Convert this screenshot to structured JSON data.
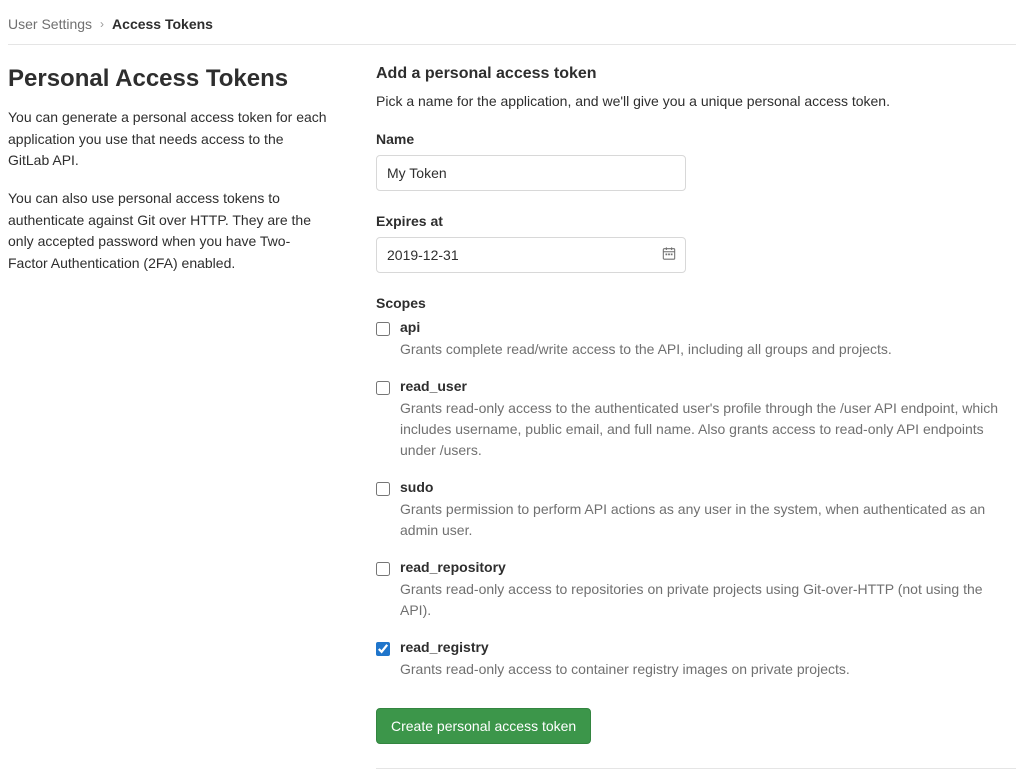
{
  "breadcrumb": {
    "root": "User Settings",
    "current": "Access Tokens"
  },
  "sidebar": {
    "heading": "Personal Access Tokens",
    "para1": "You can generate a personal access token for each application you use that needs access to the GitLab API.",
    "para2": "You can also use personal access tokens to authenticate against Git over HTTP. They are the only accepted password when you have Two-Factor Authentication (2FA) enabled."
  },
  "form": {
    "heading": "Add a personal access token",
    "subtext": "Pick a name for the application, and we'll give you a unique personal access token.",
    "name_label": "Name",
    "name_value": "My Token",
    "expires_label": "Expires at",
    "expires_value": "2019-12-31",
    "scopes_label": "Scopes",
    "submit_label": "Create personal access token"
  },
  "scopes": [
    {
      "name": "api",
      "checked": false,
      "desc": "Grants complete read/write access to the API, including all groups and projects."
    },
    {
      "name": "read_user",
      "checked": false,
      "desc": "Grants read-only access to the authenticated user's profile through the /user API endpoint, which includes username, public email, and full name. Also grants access to read-only API endpoints under /users."
    },
    {
      "name": "sudo",
      "checked": false,
      "desc": "Grants permission to perform API actions as any user in the system, when authenticated as an admin user."
    },
    {
      "name": "read_repository",
      "checked": false,
      "desc": "Grants read-only access to repositories on private projects using Git-over-HTTP (not using the API)."
    },
    {
      "name": "read_registry",
      "checked": true,
      "desc": "Grants read-only access to container registry images on private projects."
    }
  ],
  "colors": {
    "primary_green": "#3c964a",
    "checkbox_accent": "#1f75cb"
  }
}
